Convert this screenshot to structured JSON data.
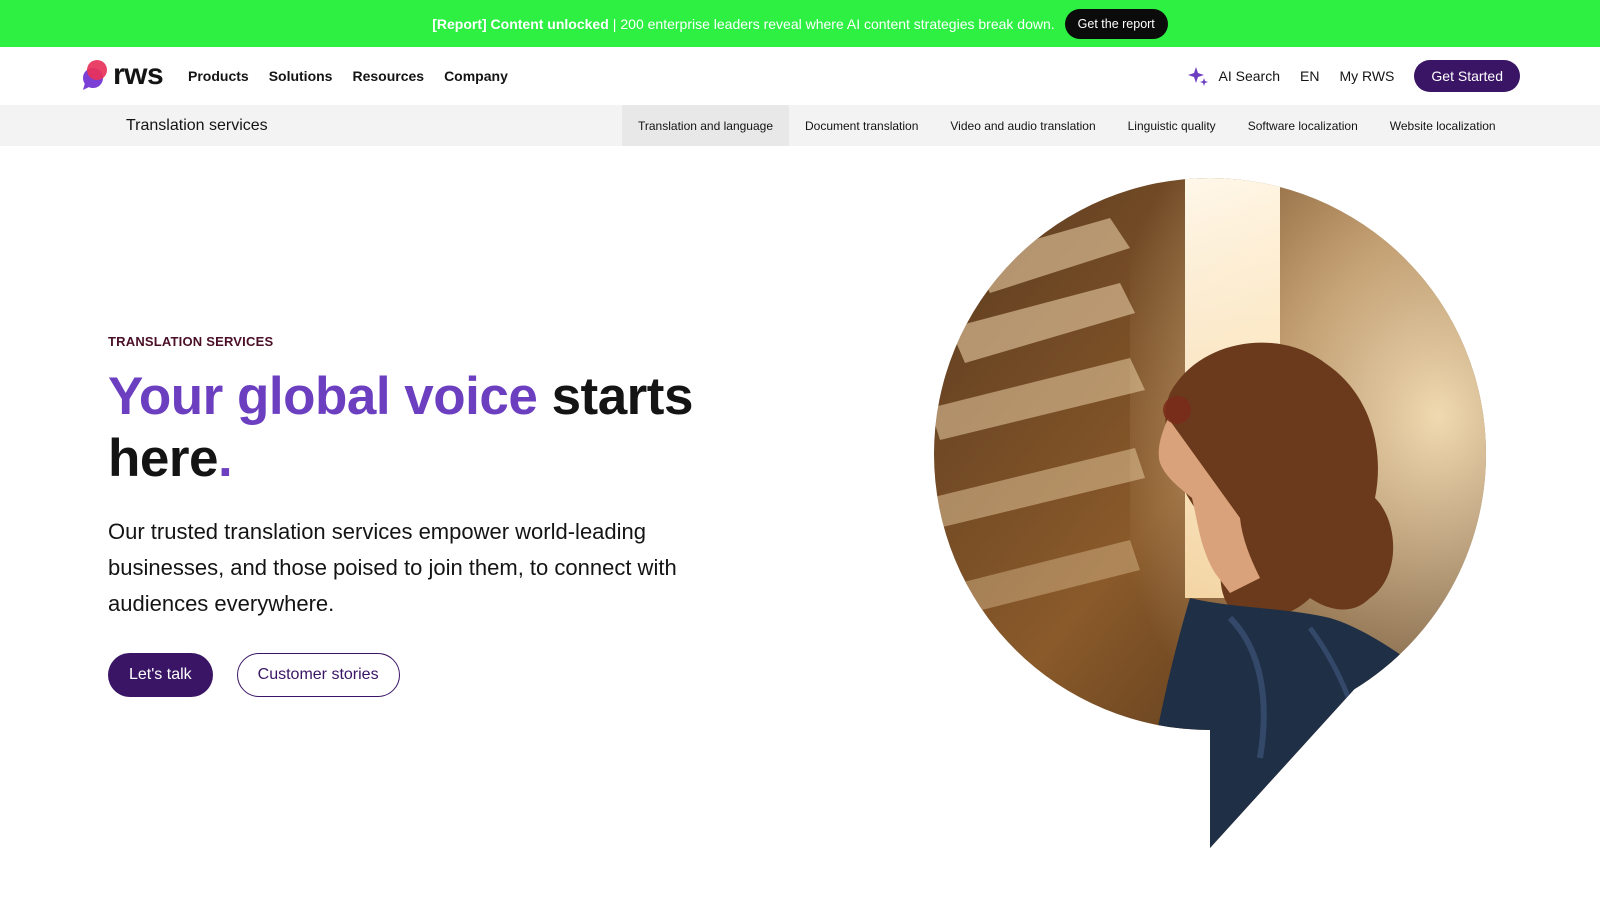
{
  "promo": {
    "bold": "[Report] Content unlocked",
    "separator": "|",
    "text": "200 enterprise leaders reveal where AI content strategies break down.",
    "button": "Get the report"
  },
  "nav": {
    "logo_text": "rws",
    "menu": [
      "Products",
      "Solutions",
      "Resources",
      "Company"
    ],
    "ai_search": "AI Search",
    "lang": "EN",
    "my_rws": "My RWS",
    "get_started": "Get Started"
  },
  "subnav": {
    "title": "Translation services",
    "links": [
      "Translation and language",
      "Document translation",
      "Video and audio translation",
      "Linguistic quality",
      "Software localization",
      "Website localization"
    ],
    "active_index": 0
  },
  "hero": {
    "eyebrow": "TRANSLATION SERVICES",
    "headline_accent": "Your global voice",
    "headline_rest": "starts here",
    "headline_period": ".",
    "intro": "Our trusted translation services empower world-leading businesses, and those poised to join them, to connect with audiences everywhere.",
    "cta_primary": "Let's talk",
    "cta_secondary": "Customer stories"
  },
  "colors": {
    "promo_bg": "#2df042",
    "brand_purple": "#3a1565",
    "accent_purple": "#6c3fc0",
    "eyebrow": "#4a0f26",
    "logo_pink": "#e8315b",
    "logo_violet": "#7b3fd6"
  },
  "icons": {
    "ai_search": "sparkle-icon",
    "logo": "speech-bubble-logo-icon"
  }
}
